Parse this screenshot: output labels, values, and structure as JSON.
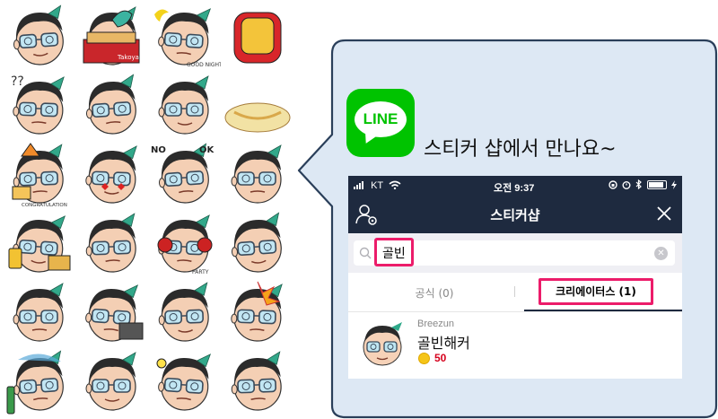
{
  "sticker_grid": {
    "items": [
      {
        "name": "sticker-face-kiss"
      },
      {
        "name": "sticker-takoyaki-box"
      },
      {
        "name": "sticker-good-night"
      },
      {
        "name": "sticker-iron-mask"
      },
      {
        "name": "sticker-confused"
      },
      {
        "name": "sticker-smirk"
      },
      {
        "name": "sticker-crying"
      },
      {
        "name": "sticker-noodle-bowl"
      },
      {
        "name": "sticker-congratulation"
      },
      {
        "name": "sticker-heart-eyes"
      },
      {
        "name": "sticker-no-ok"
      },
      {
        "name": "sticker-ok-wave"
      },
      {
        "name": "sticker-beer"
      },
      {
        "name": "sticker-whistle"
      },
      {
        "name": "sticker-party-headphones"
      },
      {
        "name": "sticker-annoyed"
      },
      {
        "name": "sticker-tired"
      },
      {
        "name": "sticker-laptop"
      },
      {
        "name": "sticker-grin"
      },
      {
        "name": "sticker-angry-fire"
      },
      {
        "name": "sticker-cold-soju"
      },
      {
        "name": "sticker-thinking"
      },
      {
        "name": "sticker-idea-bulb"
      },
      {
        "name": "sticker-sweat"
      }
    ],
    "texts": {
      "takoyaki": "Takoyaki",
      "goodnight": "GOOD NIGHT",
      "congrats": "CONGRATULATION",
      "no": "NO",
      "ok": "OK",
      "party": "PARTY",
      "question": "??"
    }
  },
  "promo": {
    "logo_text": "LINE",
    "tagline": "스티커 샵에서 만나요~"
  },
  "phone": {
    "status": {
      "carrier": "KT",
      "time": "오전 9:37"
    },
    "nav": {
      "title": "스티커샵"
    },
    "search": {
      "query": "골빈"
    },
    "tabs": {
      "official": "공식 (0)",
      "creators": "크리에이터스 (1)"
    },
    "result": {
      "creator": "Breezun",
      "pack_name": "골빈해커",
      "price": "50"
    }
  },
  "colors": {
    "line_green": "#00c300",
    "nav_dark": "#1e2a3f",
    "highlight": "#ec1c6a",
    "bubble_fill": "#dde8f4",
    "bubble_stroke": "#2a3f5a",
    "price_red": "#d6001c"
  }
}
